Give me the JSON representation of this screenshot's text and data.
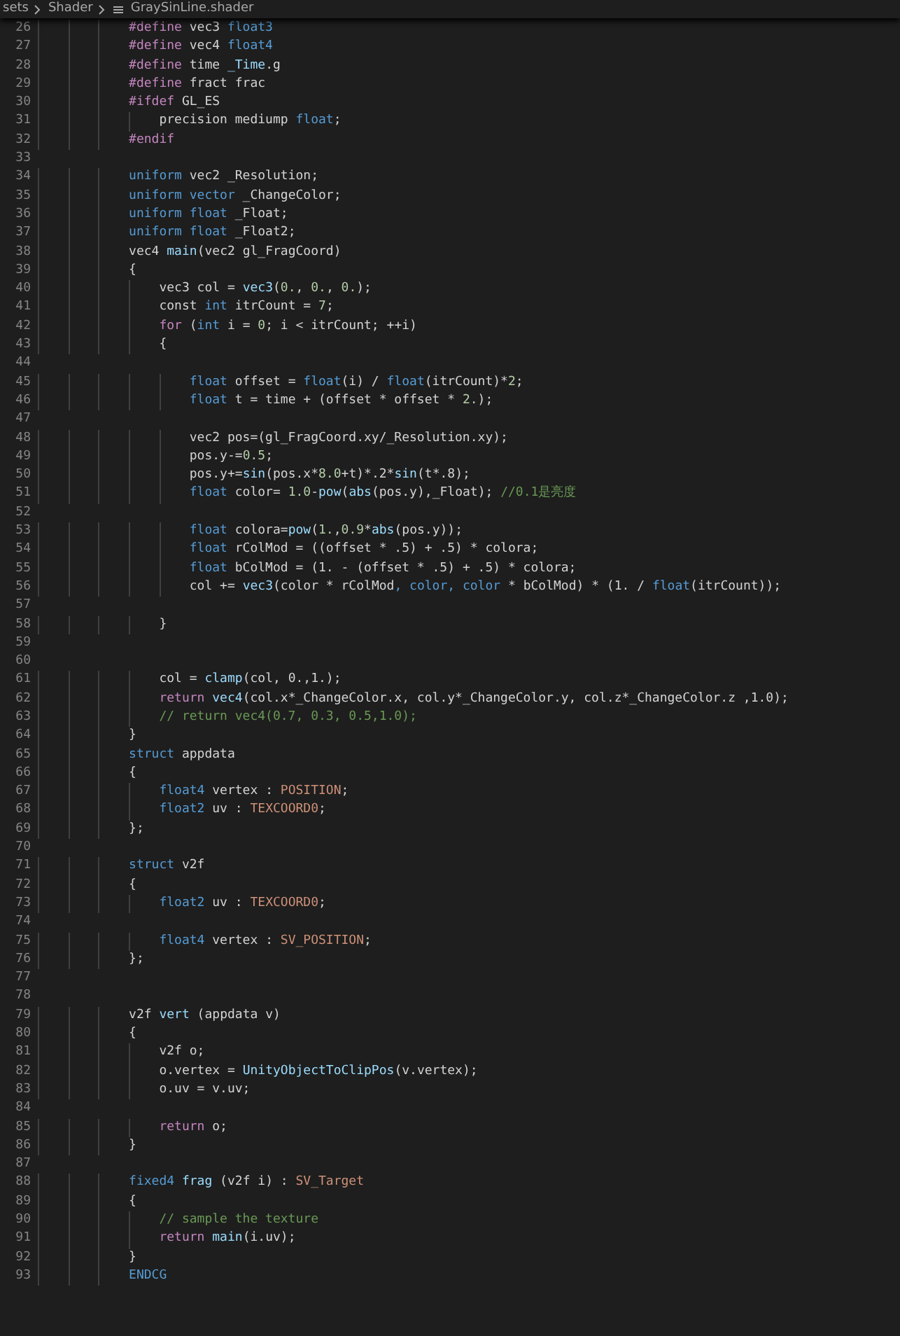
{
  "breadcrumb": {
    "items": [
      "sets",
      "Shader",
      "GraySinLine.shader"
    ]
  },
  "editor": {
    "lines": [
      {
        "number": "26",
        "tokens": [
          {
            "kind": "keyword",
            "text": "            #define"
          },
          {
            "kind": "plain",
            "text": " vec3 "
          },
          {
            "kind": "type",
            "text": "float3"
          }
        ]
      },
      {
        "number": "27",
        "tokens": [
          {
            "kind": "keyword",
            "text": "            #define"
          },
          {
            "kind": "plain",
            "text": " vec4 "
          },
          {
            "kind": "type",
            "text": "float4"
          }
        ]
      },
      {
        "number": "28",
        "tokens": [
          {
            "kind": "keyword",
            "text": "            #define"
          },
          {
            "kind": "plain",
            "text": " time "
          },
          {
            "kind": "func",
            "text": "_Time"
          },
          {
            "kind": "plain",
            "text": ".g"
          }
        ]
      },
      {
        "number": "29",
        "tokens": [
          {
            "kind": "keyword",
            "text": "            #define"
          },
          {
            "kind": "plain",
            "text": " fract frac"
          }
        ]
      },
      {
        "number": "30",
        "tokens": [
          {
            "kind": "keyword",
            "text": "            #ifdef"
          },
          {
            "kind": "plain",
            "text": " GL_ES"
          }
        ]
      },
      {
        "number": "31",
        "tokens": [
          {
            "kind": "plain",
            "text": "                precision mediump "
          },
          {
            "kind": "type",
            "text": "float"
          },
          {
            "kind": "plain",
            "text": ";"
          }
        ]
      },
      {
        "number": "32",
        "tokens": [
          {
            "kind": "keyword",
            "text": "            #endif"
          }
        ]
      },
      {
        "number": "33"
      },
      {
        "number": "34",
        "tokens": [
          {
            "kind": "type",
            "text": "            uniform"
          },
          {
            "kind": "plain",
            "text": " vec2 _Resolution;"
          }
        ]
      },
      {
        "number": "35",
        "tokens": [
          {
            "kind": "type",
            "text": "            uniform vector"
          },
          {
            "kind": "plain",
            "text": " _ChangeColor;"
          }
        ]
      },
      {
        "number": "36",
        "tokens": [
          {
            "kind": "type",
            "text": "            uniform float"
          },
          {
            "kind": "plain",
            "text": " _Float;"
          }
        ]
      },
      {
        "number": "37",
        "tokens": [
          {
            "kind": "type",
            "text": "            uniform float"
          },
          {
            "kind": "plain",
            "text": " _Float2;"
          }
        ]
      },
      {
        "number": "38",
        "tokens": [
          {
            "kind": "plain",
            "text": "            vec4 "
          },
          {
            "kind": "func",
            "text": "main"
          },
          {
            "kind": "plain",
            "text": "(vec2 gl_FragCoord)"
          }
        ]
      },
      {
        "number": "39",
        "tokens": [
          {
            "kind": "plain",
            "text": "            {"
          }
        ]
      },
      {
        "number": "40",
        "tokens": [
          {
            "kind": "plain",
            "text": "                vec3 col = "
          },
          {
            "kind": "func",
            "text": "vec3"
          },
          {
            "kind": "plain",
            "text": "("
          },
          {
            "kind": "number",
            "text": "0."
          },
          {
            "kind": "plain",
            "text": ", "
          },
          {
            "kind": "number",
            "text": "0."
          },
          {
            "kind": "plain",
            "text": ", "
          },
          {
            "kind": "number",
            "text": "0."
          },
          {
            "kind": "plain",
            "text": ");"
          }
        ]
      },
      {
        "number": "41",
        "tokens": [
          {
            "kind": "plain",
            "text": "                const "
          },
          {
            "kind": "type",
            "text": "int"
          },
          {
            "kind": "plain",
            "text": " itrCount = "
          },
          {
            "kind": "number",
            "text": "7"
          },
          {
            "kind": "plain",
            "text": ";"
          }
        ]
      },
      {
        "number": "42",
        "tokens": [
          {
            "kind": "keyword",
            "text": "                for"
          },
          {
            "kind": "plain",
            "text": " ("
          },
          {
            "kind": "type",
            "text": "int"
          },
          {
            "kind": "plain",
            "text": " i = "
          },
          {
            "kind": "number",
            "text": "0"
          },
          {
            "kind": "plain",
            "text": "; i < itrCount; ++i)"
          }
        ]
      },
      {
        "number": "43",
        "tokens": [
          {
            "kind": "plain",
            "text": "                {"
          }
        ]
      },
      {
        "number": "44"
      },
      {
        "number": "45",
        "tokens": [
          {
            "kind": "type",
            "text": "                    float"
          },
          {
            "kind": "plain",
            "text": " offset = "
          },
          {
            "kind": "type",
            "text": "float"
          },
          {
            "kind": "plain",
            "text": "(i) / "
          },
          {
            "kind": "type",
            "text": "float"
          },
          {
            "kind": "plain",
            "text": "(itrCount)*"
          },
          {
            "kind": "number",
            "text": "2"
          },
          {
            "kind": "plain",
            "text": ";"
          }
        ]
      },
      {
        "number": "46",
        "tokens": [
          {
            "kind": "type",
            "text": "                    float"
          },
          {
            "kind": "plain",
            "text": " t = time + (offset * offset * "
          },
          {
            "kind": "number",
            "text": "2."
          },
          {
            "kind": "plain",
            "text": ");"
          }
        ]
      },
      {
        "number": "47"
      },
      {
        "number": "48",
        "tokens": [
          {
            "kind": "plain",
            "text": "                    vec2 pos=(gl_FragCoord.xy/_Resolution.xy);"
          }
        ]
      },
      {
        "number": "49",
        "tokens": [
          {
            "kind": "plain",
            "text": "                    pos.y-="
          },
          {
            "kind": "number",
            "text": "0.5"
          },
          {
            "kind": "plain",
            "text": ";"
          }
        ]
      },
      {
        "number": "50",
        "tokens": [
          {
            "kind": "plain",
            "text": "                    pos.y+="
          },
          {
            "kind": "func",
            "text": "sin"
          },
          {
            "kind": "plain",
            "text": "(pos.x*"
          },
          {
            "kind": "number",
            "text": "8.0"
          },
          {
            "kind": "plain",
            "text": "+t)*.2*"
          },
          {
            "kind": "func",
            "text": "sin"
          },
          {
            "kind": "plain",
            "text": "(t*.8);"
          }
        ]
      },
      {
        "number": "51",
        "tokens": [
          {
            "kind": "type",
            "text": "                    float"
          },
          {
            "kind": "plain",
            "text": " color= "
          },
          {
            "kind": "number",
            "text": "1.0"
          },
          {
            "kind": "plain",
            "text": "-"
          },
          {
            "kind": "func",
            "text": "pow"
          },
          {
            "kind": "plain",
            "text": "("
          },
          {
            "kind": "func",
            "text": "abs"
          },
          {
            "kind": "plain",
            "text": "(pos.y),_Float); "
          },
          {
            "kind": "comment",
            "text": "//0.1是亮度"
          }
        ]
      },
      {
        "number": "52"
      },
      {
        "number": "53",
        "tokens": [
          {
            "kind": "type",
            "text": "                    float"
          },
          {
            "kind": "plain",
            "text": " colora="
          },
          {
            "kind": "func",
            "text": "pow"
          },
          {
            "kind": "plain",
            "text": "("
          },
          {
            "kind": "number",
            "text": "1."
          },
          {
            "kind": "plain",
            "text": ","
          },
          {
            "kind": "number",
            "text": "0.9"
          },
          {
            "kind": "plain",
            "text": "*"
          },
          {
            "kind": "func",
            "text": "abs"
          },
          {
            "kind": "plain",
            "text": "(pos.y));"
          }
        ]
      },
      {
        "number": "54",
        "tokens": [
          {
            "kind": "type",
            "text": "                    float"
          },
          {
            "kind": "plain",
            "text": " rColMod = ((offset * .5) + .5) * colora;"
          }
        ]
      },
      {
        "number": "55",
        "tokens": [
          {
            "kind": "type",
            "text": "                    float"
          },
          {
            "kind": "plain",
            "text": " bColMod = (1. - (offset * .5) + .5) * colora;"
          }
        ]
      },
      {
        "number": "56",
        "tokens": [
          {
            "kind": "plain",
            "text": "                    col += "
          },
          {
            "kind": "func",
            "text": "vec3"
          },
          {
            "kind": "plain",
            "text": "(color * rColMod"
          },
          {
            "kind": "type",
            "text": ", color, color"
          },
          {
            "kind": "plain",
            "text": " * bColMod) * (1. / "
          },
          {
            "kind": "type",
            "text": "float"
          },
          {
            "kind": "plain",
            "text": "(itrCount));"
          }
        ]
      },
      {
        "number": "57"
      },
      {
        "number": "58",
        "tokens": [
          {
            "kind": "plain",
            "text": "                }"
          }
        ]
      },
      {
        "number": "59"
      },
      {
        "number": "60"
      },
      {
        "number": "61",
        "tokens": [
          {
            "kind": "plain",
            "text": "                col = "
          },
          {
            "kind": "func",
            "text": "clamp"
          },
          {
            "kind": "plain",
            "text": "(col, 0.,1.);"
          }
        ]
      },
      {
        "number": "62",
        "tokens": [
          {
            "kind": "keyword",
            "text": "                return "
          },
          {
            "kind": "func",
            "text": "vec4"
          },
          {
            "kind": "plain",
            "text": "(col.x*_ChangeColor.x, col.y*_ChangeColor.y, col.z*_ChangeColor.z ,1.0);"
          }
        ]
      },
      {
        "number": "63",
        "tokens": [
          {
            "kind": "comment",
            "text": "                // return vec4(0.7, 0.3, 0.5,1.0);"
          }
        ]
      },
      {
        "number": "64",
        "tokens": [
          {
            "kind": "plain",
            "text": "            }"
          }
        ]
      },
      {
        "number": "65",
        "tokens": [
          {
            "kind": "type",
            "text": "            struct"
          },
          {
            "kind": "plain",
            "text": " appdata"
          }
        ]
      },
      {
        "number": "66",
        "tokens": [
          {
            "kind": "plain",
            "text": "            {"
          }
        ]
      },
      {
        "number": "67",
        "tokens": [
          {
            "kind": "type",
            "text": "                float4"
          },
          {
            "kind": "plain",
            "text": " vertex : "
          },
          {
            "kind": "semantic",
            "text": "POSITION"
          },
          {
            "kind": "plain",
            "text": ";"
          }
        ]
      },
      {
        "number": "68",
        "tokens": [
          {
            "kind": "type",
            "text": "                float2"
          },
          {
            "kind": "plain",
            "text": " uv : "
          },
          {
            "kind": "semantic",
            "text": "TEXCOORD0"
          },
          {
            "kind": "plain",
            "text": ";"
          }
        ]
      },
      {
        "number": "69",
        "tokens": [
          {
            "kind": "plain",
            "text": "            };"
          }
        ]
      },
      {
        "number": "70"
      },
      {
        "number": "71",
        "tokens": [
          {
            "kind": "type",
            "text": "            struct"
          },
          {
            "kind": "plain",
            "text": " v2f"
          }
        ]
      },
      {
        "number": "72",
        "tokens": [
          {
            "kind": "plain",
            "text": "            {"
          }
        ]
      },
      {
        "number": "73",
        "tokens": [
          {
            "kind": "type",
            "text": "                float2"
          },
          {
            "kind": "plain",
            "text": " uv : "
          },
          {
            "kind": "semantic",
            "text": "TEXCOORD0"
          },
          {
            "kind": "plain",
            "text": ";"
          }
        ]
      },
      {
        "number": "74"
      },
      {
        "number": "75",
        "tokens": [
          {
            "kind": "type",
            "text": "                float4"
          },
          {
            "kind": "plain",
            "text": " vertex : "
          },
          {
            "kind": "semantic",
            "text": "SV_POSITION"
          },
          {
            "kind": "plain",
            "text": ";"
          }
        ]
      },
      {
        "number": "76",
        "tokens": [
          {
            "kind": "plain",
            "text": "            };"
          }
        ]
      },
      {
        "number": "77"
      },
      {
        "number": "78"
      },
      {
        "number": "79",
        "tokens": [
          {
            "kind": "plain",
            "text": "            v2f "
          },
          {
            "kind": "func",
            "text": "vert"
          },
          {
            "kind": "plain",
            "text": " (appdata v)"
          }
        ]
      },
      {
        "number": "80",
        "tokens": [
          {
            "kind": "plain",
            "text": "            {"
          }
        ]
      },
      {
        "number": "81",
        "tokens": [
          {
            "kind": "plain",
            "text": "                v2f o;"
          }
        ]
      },
      {
        "number": "82",
        "tokens": [
          {
            "kind": "plain",
            "text": "                o.vertex = "
          },
          {
            "kind": "func",
            "text": "UnityObjectToClipPos"
          },
          {
            "kind": "plain",
            "text": "(v.vertex);"
          }
        ]
      },
      {
        "number": "83",
        "tokens": [
          {
            "kind": "plain",
            "text": "                o.uv = v.uv;"
          }
        ]
      },
      {
        "number": "84"
      },
      {
        "number": "85",
        "tokens": [
          {
            "kind": "keyword",
            "text": "                return"
          },
          {
            "kind": "plain",
            "text": " o;"
          }
        ]
      },
      {
        "number": "86",
        "tokens": [
          {
            "kind": "plain",
            "text": "            }"
          }
        ]
      },
      {
        "number": "87"
      },
      {
        "number": "88",
        "tokens": [
          {
            "kind": "type",
            "text": "            fixed4 "
          },
          {
            "kind": "func",
            "text": "frag"
          },
          {
            "kind": "plain",
            "text": " (v2f i) : "
          },
          {
            "kind": "semantic",
            "text": "SV_Target"
          }
        ]
      },
      {
        "number": "89",
        "tokens": [
          {
            "kind": "plain",
            "text": "            {"
          }
        ]
      },
      {
        "number": "90",
        "tokens": [
          {
            "kind": "comment",
            "text": "                // sample the texture"
          }
        ]
      },
      {
        "number": "91",
        "tokens": [
          {
            "kind": "keyword",
            "text": "                return "
          },
          {
            "kind": "func",
            "text": "main"
          },
          {
            "kind": "plain",
            "text": "(i.uv);"
          }
        ]
      },
      {
        "number": "92",
        "tokens": [
          {
            "kind": "plain",
            "text": "            }"
          }
        ]
      },
      {
        "number": "93",
        "tokens": [
          {
            "kind": "type",
            "text": "            ENDCG"
          }
        ]
      }
    ]
  }
}
